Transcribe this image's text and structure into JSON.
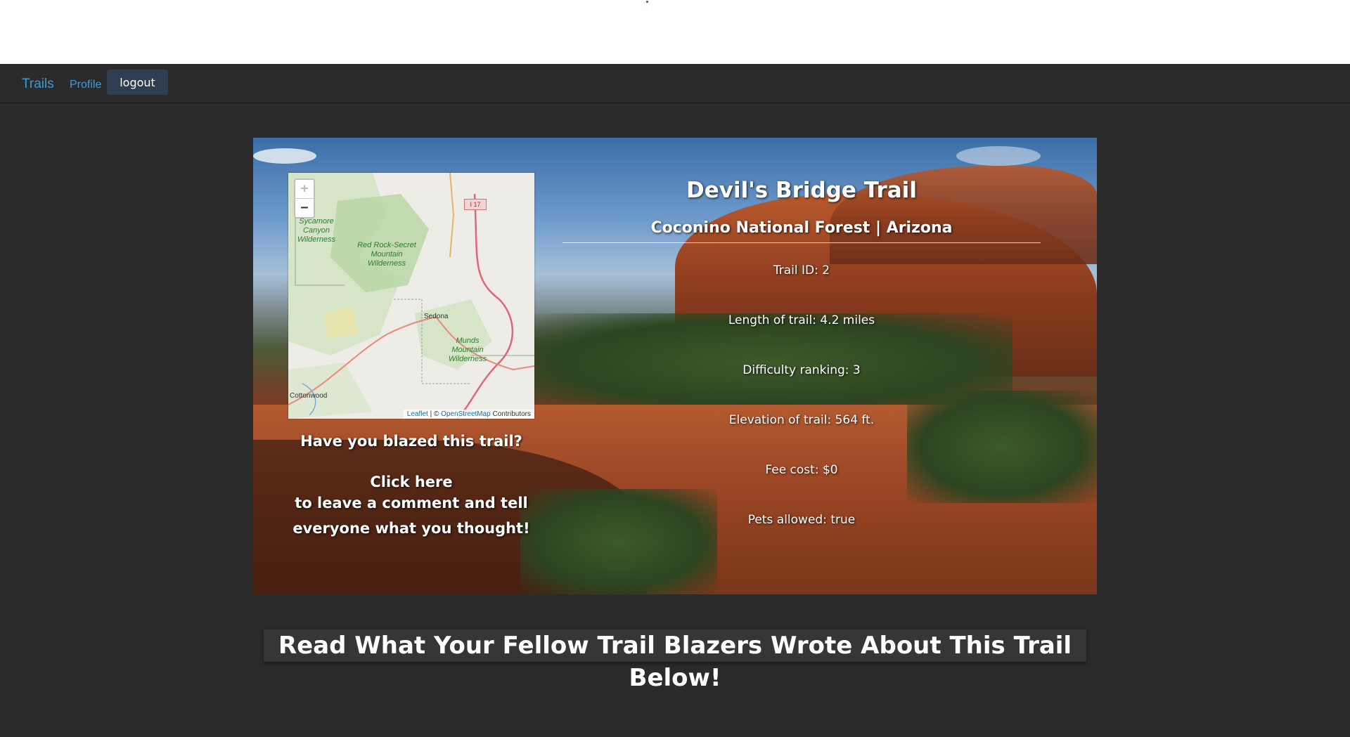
{
  "navbar": {
    "brand": "Trails",
    "profile_link": "Profile",
    "logout_label": "logout"
  },
  "map": {
    "zoom_in": "+",
    "zoom_out": "−",
    "labels": {
      "sycamore": "Sycamore Canyon Wilderness",
      "redrock": "Red Rock-Secret Mountain Wilderness",
      "munds": "Munds Mountain Wilderness",
      "sedona": "Sedona",
      "cottonwood": "Cottonwood",
      "highway": "I 17"
    },
    "attribution": {
      "leaflet": "Leaflet",
      "separator": " | © ",
      "osm": "OpenStreetMap",
      "suffix": " Contributors"
    }
  },
  "trail": {
    "name": "Devil's Bridge Trail",
    "location": "Coconino National Forest | Arizona",
    "stats": [
      "Trail ID: 2",
      "Length of trail: 4.2 miles",
      "Difficulty ranking: 3",
      "Elevation of trail: 564 ft.",
      "Fee cost: $0",
      "Pets allowed: true"
    ]
  },
  "blaze": {
    "question": "Have you blazed this trail?",
    "link": "Click here",
    "line1": "to leave a comment and tell",
    "line2": "everyone what you thought!"
  },
  "reviews": {
    "heading": "Read What Your Fellow Trail Blazers Wrote About This Trail Below!"
  },
  "colors": {
    "page_bg": "#2b2b2b",
    "link": "#3e9ad6",
    "button_bg": "#2f3e50"
  }
}
